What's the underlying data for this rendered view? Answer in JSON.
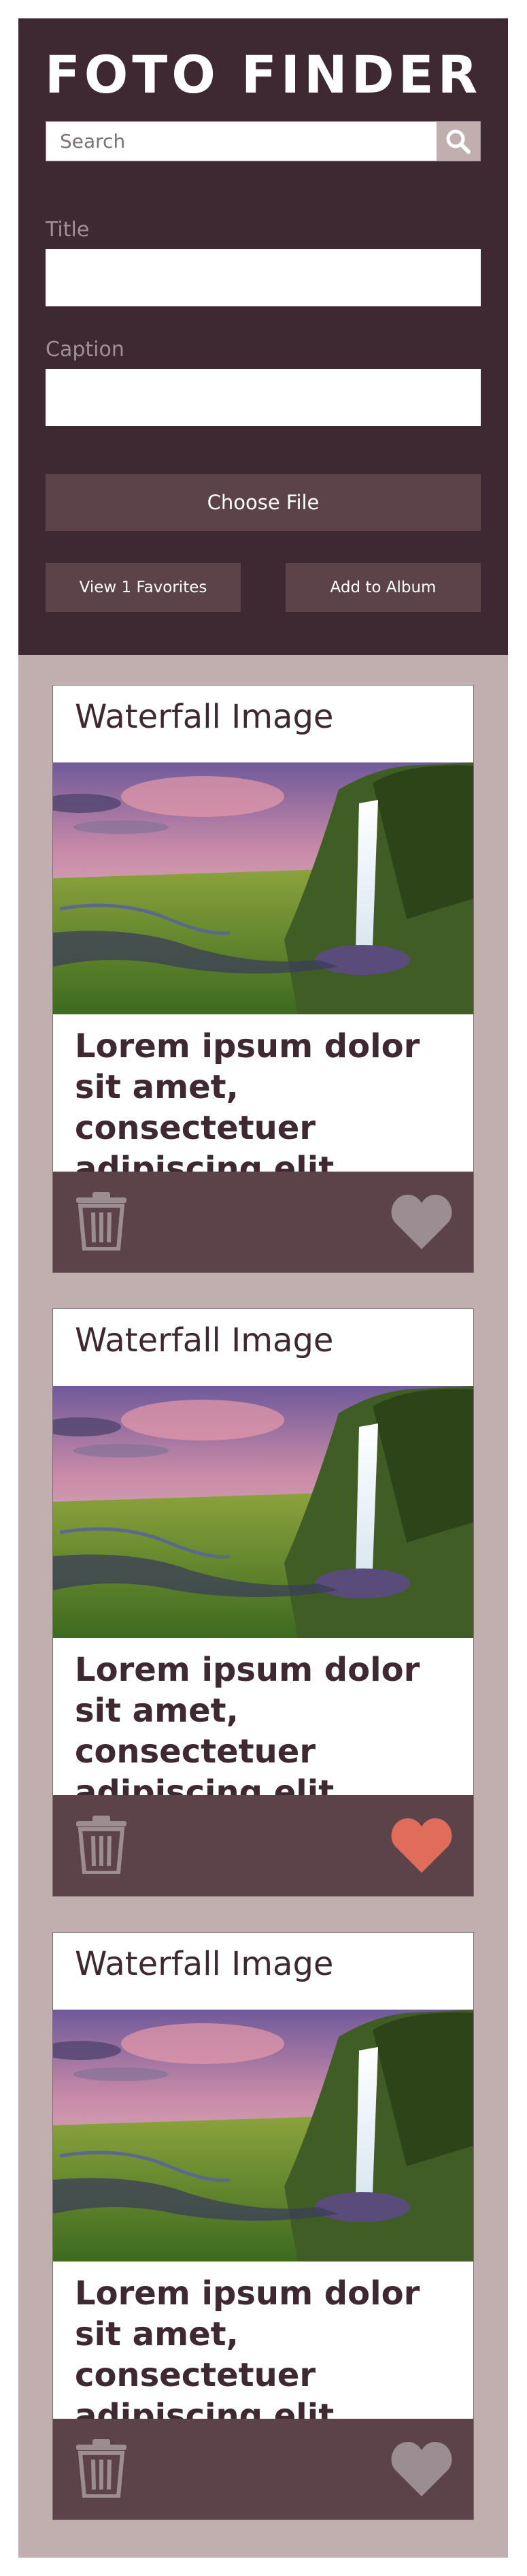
{
  "header": {
    "logo_left": "FOTO",
    "logo_right": "FINDER",
    "search_placeholder": "Search",
    "title_label": "Title",
    "caption_label": "Caption",
    "choose_file_label": "Choose File",
    "view_favorites_label": "View 1 Favorites",
    "add_album_label": "Add to Album"
  },
  "colors": {
    "header_bg": "#3e2933",
    "button_bg": "#5c4249",
    "page_bg": "#c1afb0",
    "accent": "#e06d5b",
    "icon_inactive": "#9c8d92"
  },
  "cards": [
    {
      "title": "Waterfall Image",
      "caption": "Lorem ipsum dolor sit amet, consectetuer adipiscing elit.",
      "favorited": false,
      "icons": [
        "trash-icon",
        "heart-icon"
      ]
    },
    {
      "title": "Waterfall Image",
      "caption": "Lorem ipsum dolor sit amet, consectetuer adipiscing elit.",
      "favorited": true,
      "icons": [
        "trash-icon",
        "heart-icon"
      ]
    },
    {
      "title": "Waterfall Image",
      "caption": "Lorem ipsum dolor sit amet, consectetuer adipiscing elit.",
      "favorited": false,
      "icons": [
        "trash-icon",
        "heart-icon"
      ]
    }
  ]
}
